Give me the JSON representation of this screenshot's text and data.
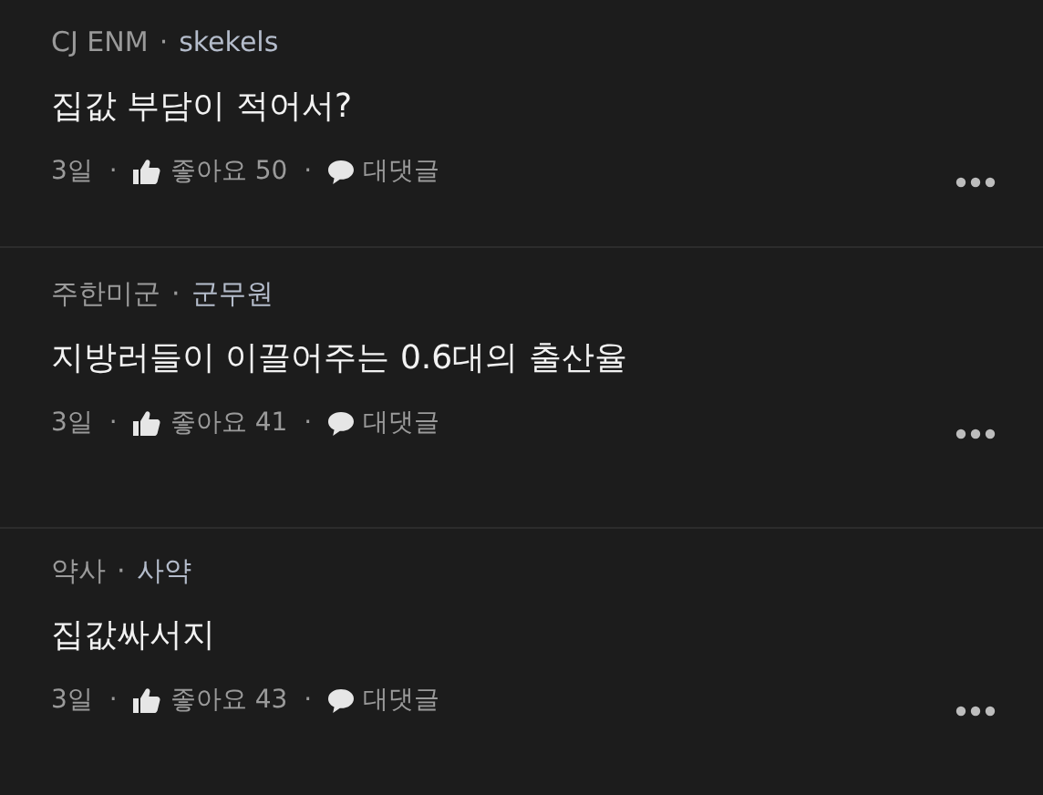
{
  "comments": [
    {
      "company": "CJ ENM",
      "separator": "·",
      "nickname": "skekels",
      "body": "집값 부담이 적어서?",
      "date": "3일",
      "like_label": "좋아요 50",
      "reply_label": "대댓글"
    },
    {
      "company": "주한미군",
      "separator": "·",
      "nickname": "군무원",
      "body": "지방러들이 이끌어주는 0.6대의 출산율",
      "date": "3일",
      "like_label": "좋아요 41",
      "reply_label": "대댓글"
    },
    {
      "company": "약사",
      "separator": "·",
      "nickname": "사약",
      "body": "집값싸서지",
      "date": "3일",
      "like_label": "좋아요 43",
      "reply_label": "대댓글"
    }
  ]
}
